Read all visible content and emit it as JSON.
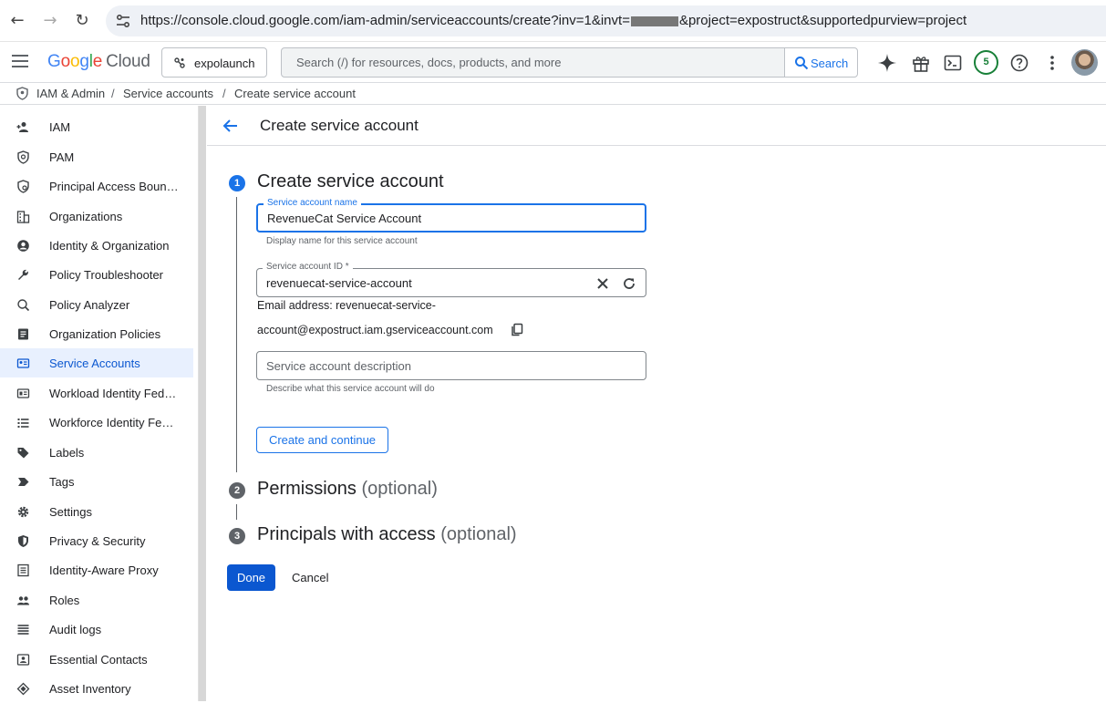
{
  "browser": {
    "url_prefix": "https://console.cloud.google.com/iam-admin/serviceaccounts/create?inv=1&invt=",
    "url_suffix": "&project=expostruct&supportedpurview=project"
  },
  "header": {
    "logo_google": "Google",
    "logo_cloud": "Cloud",
    "project": "expolaunch",
    "search_placeholder": "Search (/) for resources, docs, products, and more",
    "search_button": "Search",
    "notification_count": "5"
  },
  "breadcrumb": {
    "items": [
      "IAM & Admin",
      "Service accounts",
      "Create service account"
    ]
  },
  "sidebar": {
    "items": [
      {
        "label": "IAM",
        "icon": "person-add-icon"
      },
      {
        "label": "PAM",
        "icon": "shield-icon"
      },
      {
        "label": "Principal Access Boun…",
        "icon": "policy-icon"
      },
      {
        "label": "Organizations",
        "icon": "building-icon"
      },
      {
        "label": "Identity & Organization",
        "icon": "account-circle-icon"
      },
      {
        "label": "Policy Troubleshooter",
        "icon": "wrench-icon"
      },
      {
        "label": "Policy Analyzer",
        "icon": "analyzer-icon"
      },
      {
        "label": "Organization Policies",
        "icon": "list-doc-icon"
      },
      {
        "label": "Service Accounts",
        "icon": "service-account-icon",
        "active": true
      },
      {
        "label": "Workload Identity Fede…",
        "icon": "id-card-icon"
      },
      {
        "label": "Workforce Identity Fed…",
        "icon": "list-icon"
      },
      {
        "label": "Labels",
        "icon": "label-icon"
      },
      {
        "label": "Tags",
        "icon": "tag-icon"
      },
      {
        "label": "Settings",
        "icon": "gear-icon"
      },
      {
        "label": "Privacy & Security",
        "icon": "security-shield-icon"
      },
      {
        "label": "Identity-Aware Proxy",
        "icon": "proxy-icon"
      },
      {
        "label": "Roles",
        "icon": "roles-icon"
      },
      {
        "label": "Audit logs",
        "icon": "logs-icon"
      },
      {
        "label": "Essential Contacts",
        "icon": "contacts-icon"
      },
      {
        "label": "Asset Inventory",
        "icon": "inventory-icon"
      }
    ]
  },
  "page": {
    "title": "Create service account"
  },
  "steps": [
    {
      "number": "1",
      "title": "Create service account",
      "optional": ""
    },
    {
      "number": "2",
      "title": "Permissions",
      "optional": "(optional)"
    },
    {
      "number": "3",
      "title": "Principals with access",
      "optional": "(optional)"
    }
  ],
  "form": {
    "name_label": "Service account name",
    "name_value": "RevenueCat Service Account",
    "name_hint": "Display name for this service account",
    "id_label": "Service account ID *",
    "id_value": "revenuecat-service-account",
    "email_line1": "Email address: revenuecat-service-",
    "email_line2": "account@expostruct.iam.gserviceaccount.com",
    "description_placeholder": "Service account description",
    "description_hint": "Describe what this service account will do",
    "create_continue": "Create and continue"
  },
  "actions": {
    "done": "Done",
    "cancel": "Cancel"
  },
  "colors": {
    "accent": "#1a73e8",
    "active_bg": "#e8f0fe",
    "primary": "#0b57d0"
  }
}
